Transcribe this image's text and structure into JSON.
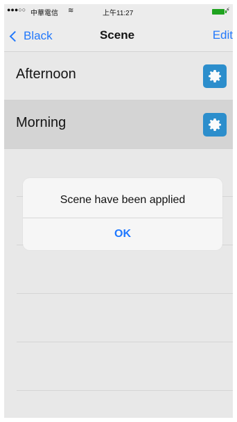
{
  "status_bar": {
    "signal": "●●●○○",
    "carrier": "中華電信",
    "wifi_icon": "wifi-icon",
    "time": "上午11:27",
    "battery_color": "#1fa31f",
    "charging_icon": "charging-icon"
  },
  "nav": {
    "back_label": "Black",
    "title": "Scene",
    "edit_label": "Edit",
    "accent_color": "#1f78ff"
  },
  "scenes": [
    {
      "label": "Afternoon",
      "selected": false,
      "icon": "gear-icon"
    },
    {
      "label": "Morning",
      "selected": true,
      "icon": "gear-icon"
    }
  ],
  "alert": {
    "message": "Scene have been applied",
    "ok_label": "OK"
  }
}
